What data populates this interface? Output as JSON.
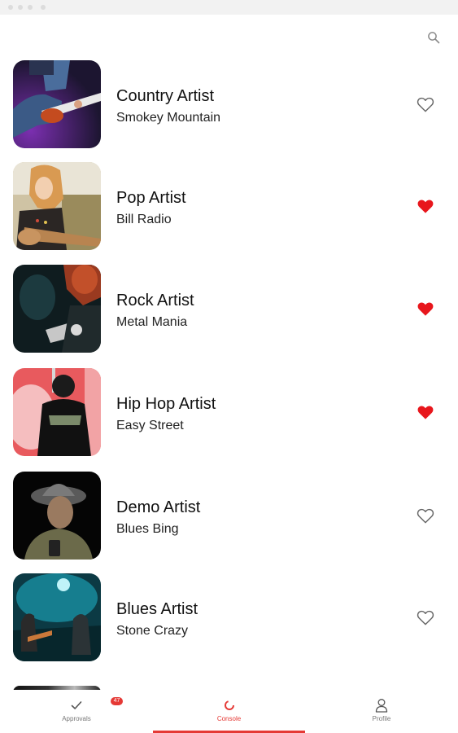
{
  "header": {
    "search_icon": "search-icon"
  },
  "artists": [
    {
      "name": "Country Artist",
      "station": "Smokey Mountain",
      "favorite": false
    },
    {
      "name": "Pop Artist",
      "station": "Bill Radio",
      "favorite": true
    },
    {
      "name": "Rock Artist",
      "station": "Metal Mania",
      "favorite": true
    },
    {
      "name": "Hip Hop Artist",
      "station": "Easy Street",
      "favorite": true
    },
    {
      "name": "Demo Artist",
      "station": "Blues Bing",
      "favorite": false
    },
    {
      "name": "Blues Artist",
      "station": "Stone Crazy",
      "favorite": false
    }
  ],
  "tabs": {
    "approvals": {
      "label": "Approvals",
      "badge": "47",
      "icon": "check-icon"
    },
    "console": {
      "label": "Console",
      "icon": "console-icon",
      "active": true
    },
    "profile": {
      "label": "Profile",
      "icon": "person-icon"
    }
  },
  "colors": {
    "accent": "#e53935",
    "heart_outline": "#666666",
    "text": "#111111"
  }
}
